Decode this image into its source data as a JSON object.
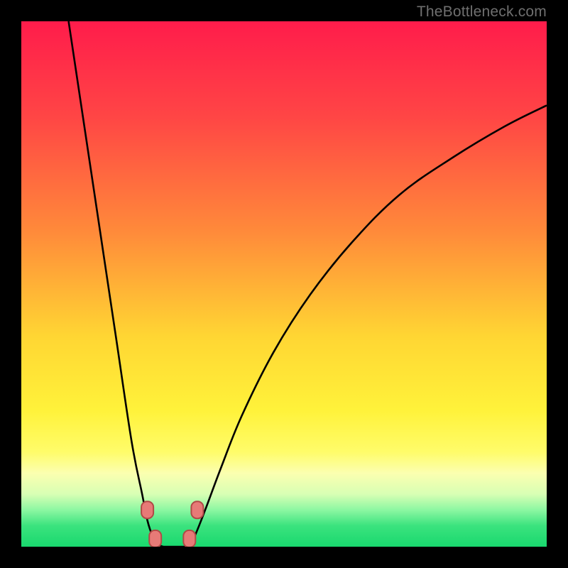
{
  "watermark": "TheBottleneck.com",
  "colors": {
    "frame": "#000000",
    "gradient_stops": [
      {
        "pos": 0.0,
        "color": "#ff1c4b"
      },
      {
        "pos": 0.18,
        "color": "#ff4545"
      },
      {
        "pos": 0.4,
        "color": "#ff8a3a"
      },
      {
        "pos": 0.6,
        "color": "#ffd633"
      },
      {
        "pos": 0.74,
        "color": "#fff23a"
      },
      {
        "pos": 0.82,
        "color": "#fffc6a"
      },
      {
        "pos": 0.86,
        "color": "#fbffb0"
      },
      {
        "pos": 0.9,
        "color": "#d8ffb4"
      },
      {
        "pos": 0.93,
        "color": "#8cf7a2"
      },
      {
        "pos": 0.96,
        "color": "#3be37e"
      },
      {
        "pos": 1.0,
        "color": "#19d86e"
      }
    ],
    "curve": "#000000",
    "marker_fill": "#e77a77",
    "marker_stroke": "#b04a46"
  },
  "chart_data": {
    "type": "line",
    "title": "",
    "xlabel": "",
    "ylabel": "",
    "xlim": [
      0,
      100
    ],
    "ylim": [
      0,
      100
    ],
    "left_branch": [
      {
        "x": 9,
        "y": 100
      },
      {
        "x": 12,
        "y": 80
      },
      {
        "x": 15,
        "y": 60
      },
      {
        "x": 18,
        "y": 40
      },
      {
        "x": 21,
        "y": 20
      },
      {
        "x": 23,
        "y": 10
      },
      {
        "x": 24,
        "y": 5
      },
      {
        "x": 25,
        "y": 2
      },
      {
        "x": 26,
        "y": 0.5
      },
      {
        "x": 27,
        "y": 0
      }
    ],
    "right_branch": [
      {
        "x": 31,
        "y": 0
      },
      {
        "x": 32,
        "y": 0.5
      },
      {
        "x": 33,
        "y": 2
      },
      {
        "x": 35,
        "y": 7
      },
      {
        "x": 38,
        "y": 15
      },
      {
        "x": 42,
        "y": 25
      },
      {
        "x": 48,
        "y": 37
      },
      {
        "x": 55,
        "y": 48
      },
      {
        "x": 63,
        "y": 58
      },
      {
        "x": 72,
        "y": 67
      },
      {
        "x": 82,
        "y": 74
      },
      {
        "x": 92,
        "y": 80
      },
      {
        "x": 100,
        "y": 84
      }
    ],
    "baseline": [
      {
        "x": 27,
        "y": 0
      },
      {
        "x": 31,
        "y": 0
      }
    ],
    "markers": [
      {
        "x": 24.0,
        "y": 7
      },
      {
        "x": 33.5,
        "y": 7
      },
      {
        "x": 25.5,
        "y": 1.5
      },
      {
        "x": 32.0,
        "y": 1.5
      }
    ]
  }
}
